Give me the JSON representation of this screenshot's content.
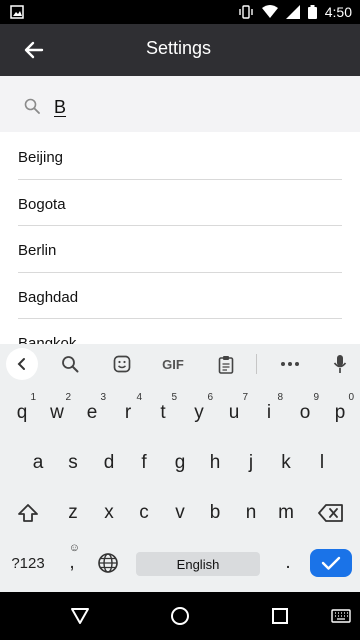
{
  "status_bar": {
    "time": "4:50"
  },
  "app_bar": {
    "title": "Settings"
  },
  "search": {
    "value": "B"
  },
  "cities": [
    "Beijing",
    "Bogota",
    "Berlin",
    "Baghdad",
    "Bangkok"
  ],
  "keyboard": {
    "toolbar": {
      "gif_label": "GIF"
    },
    "row1": [
      {
        "k": "q",
        "n": "1"
      },
      {
        "k": "w",
        "n": "2"
      },
      {
        "k": "e",
        "n": "3"
      },
      {
        "k": "r",
        "n": "4"
      },
      {
        "k": "t",
        "n": "5"
      },
      {
        "k": "y",
        "n": "6"
      },
      {
        "k": "u",
        "n": "7"
      },
      {
        "k": "i",
        "n": "8"
      },
      {
        "k": "o",
        "n": "9"
      },
      {
        "k": "p",
        "n": "0"
      }
    ],
    "row2": [
      "a",
      "s",
      "d",
      "f",
      "g",
      "h",
      "j",
      "k",
      "l"
    ],
    "row3": [
      "z",
      "x",
      "c",
      "v",
      "b",
      "n",
      "m"
    ],
    "symbols_label": "?123",
    "comma_label": ",",
    "emoji_hint": "☺",
    "space_label": "English",
    "period_label": "."
  }
}
